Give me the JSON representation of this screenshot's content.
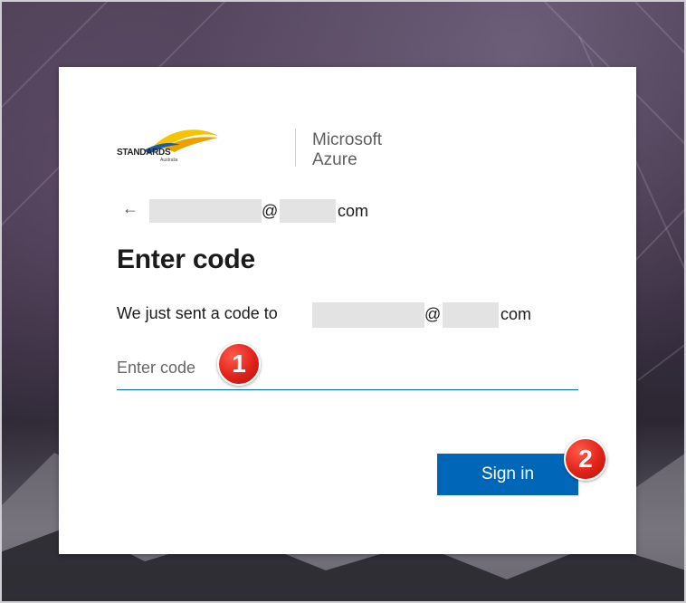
{
  "branding": {
    "org_name": "STANDARDS",
    "org_sub": "Australia",
    "product_line1": "Microsoft",
    "product_line2": "Azure"
  },
  "account": {
    "back_arrow": "←",
    "at_sign": "@",
    "domain_suffix": "com"
  },
  "page": {
    "title": "Enter code",
    "sent_message": "We just sent a code to",
    "at_sign": "@",
    "domain_suffix": "com"
  },
  "code_input": {
    "placeholder": "Enter code",
    "value": ""
  },
  "actions": {
    "sign_in_label": "Sign in"
  },
  "annotations": {
    "step1": "1",
    "step2": "2"
  },
  "colors": {
    "accent": "#0067b8",
    "badge": "#e0231a",
    "logo_yellow": "#f5c400"
  }
}
